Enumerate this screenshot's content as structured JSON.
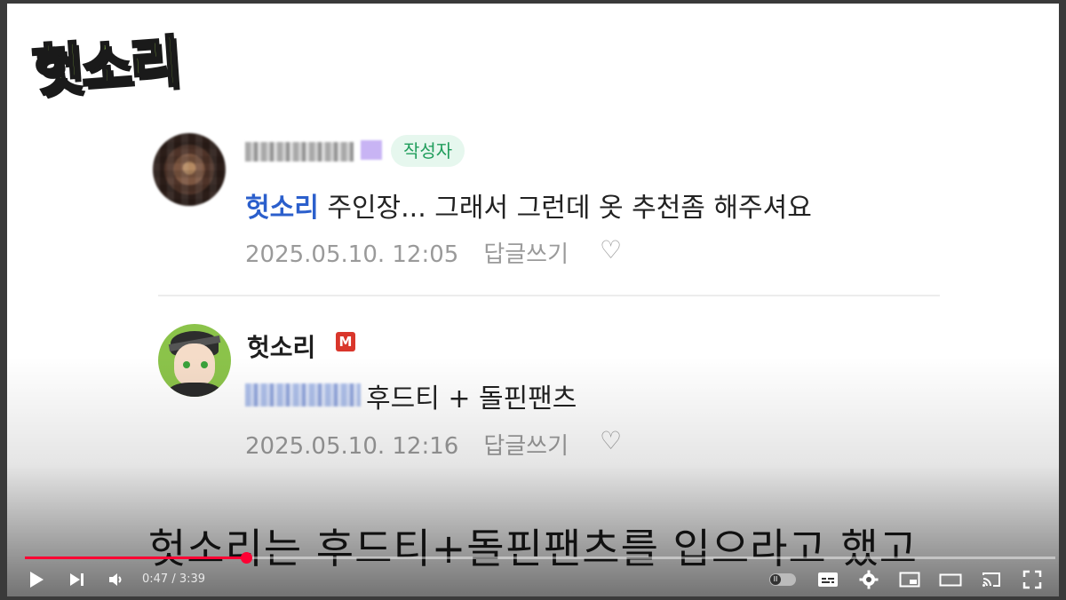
{
  "logo": {
    "text": "헛소리"
  },
  "comments": [
    {
      "author_badge": "작성자",
      "mention": "헛소리",
      "text": " 주인장... 그래서 그런데 옷 추천좀 해주셔요",
      "date": "2025.05.10. 12:05",
      "reply": "답글쓰기"
    },
    {
      "username": "헛소리",
      "user_badge": "M",
      "text": "후드티 + 돌핀팬츠",
      "date": "2025.05.10. 12:16",
      "reply": "답글쓰기"
    }
  ],
  "subtitle": "헛소리는 후드티+돌핀팬츠를 입으라고 했고",
  "player": {
    "current_time": "0:47",
    "duration": "3:39",
    "time_display": "0:47 / 3:39",
    "progress_fraction": 0.2146,
    "accent_color": "#ff0033"
  },
  "icons": {
    "play": "play-icon",
    "next": "next-icon",
    "volume": "volume-icon",
    "autoplay": "autoplay-toggle",
    "subtitles": "subtitles-icon",
    "settings": "gear-icon",
    "miniplayer": "miniplayer-icon",
    "theater": "theater-icon",
    "cast": "cast-icon",
    "fullscreen": "fullscreen-icon",
    "heart": "heart-icon"
  }
}
